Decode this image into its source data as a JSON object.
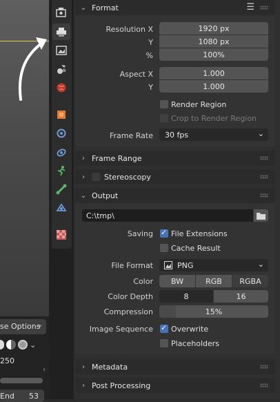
{
  "viewport": {
    "options_label": "se Options",
    "frame_value": "250",
    "end_label": "End",
    "end_value": "53"
  },
  "format": {
    "title": "Format",
    "resolution_x_label": "Resolution X",
    "resolution_x": "1920 px",
    "resolution_y_label": "Y",
    "resolution_y": "1080 px",
    "percent_label": "%",
    "percent": "100%",
    "aspect_x_label": "Aspect X",
    "aspect_x": "1.000",
    "aspect_y_label": "Y",
    "aspect_y": "1.000",
    "render_region": "Render Region",
    "crop_region": "Crop to Render Region",
    "frame_rate_label": "Frame Rate",
    "frame_rate": "30 fps"
  },
  "frame_range": {
    "title": "Frame Range"
  },
  "stereoscopy": {
    "title": "Stereoscopy"
  },
  "output": {
    "title": "Output",
    "path": "C:\\tmp\\",
    "saving_label": "Saving",
    "file_extensions": "File Extensions",
    "cache_result": "Cache Result",
    "file_format_label": "File Format",
    "file_format": "PNG",
    "color_label": "Color",
    "color_options": [
      "BW",
      "RGB",
      "RGBA"
    ],
    "color_depth_label": "Color Depth",
    "color_depth_options": [
      "8",
      "16"
    ],
    "compression_label": "Compression",
    "compression": "15%",
    "compression_fraction": 0.15,
    "image_sequence_label": "Image Sequence",
    "overwrite": "Overwrite",
    "placeholders": "Placeholders"
  },
  "metadata": {
    "title": "Metadata"
  },
  "post_processing": {
    "title": "Post Processing"
  }
}
